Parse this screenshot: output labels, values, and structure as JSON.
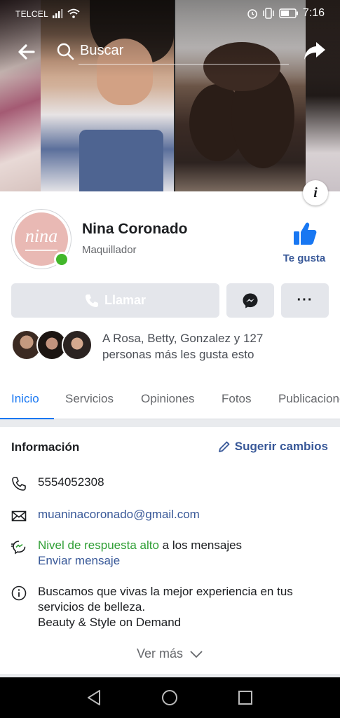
{
  "status_bar": {
    "carrier": "TELCEL",
    "time": "7:16"
  },
  "search": {
    "placeholder": "Buscar"
  },
  "page": {
    "name": "Nina Coronado",
    "category": "Maquillador",
    "avatar_logo": "nina",
    "like_label": "Te gusta"
  },
  "actions": {
    "call_label": "Llamar",
    "more_label": "···"
  },
  "friends_text": "A Rosa, Betty, Gonzalez y 127 personas más les gusta esto",
  "tabs": [
    {
      "label": "Inicio",
      "active": true
    },
    {
      "label": "Servicios",
      "active": false
    },
    {
      "label": "Opiniones",
      "active": false
    },
    {
      "label": "Fotos",
      "active": false
    },
    {
      "label": "Publicaciones",
      "active": false
    }
  ],
  "info": {
    "title": "Información",
    "suggest_label": "Sugerir cambios",
    "phone": "5554052308",
    "email": "muaninacoronado@gmail.com",
    "response_highlight": "Nivel de respuesta alto",
    "response_rest": " a los mensajes",
    "send_message": "Enviar mensaje",
    "about_line1": "Buscamos que vivas la mejor experiencia en tus",
    "about_line2": "servicios de belleza.",
    "about_line3": "Beauty & Style on Demand",
    "see_more": "Ver más"
  },
  "colors": {
    "accent_blue": "#1877f2",
    "link_blue": "#385898",
    "online_green": "#42b72a",
    "response_green": "#2e9e34"
  }
}
